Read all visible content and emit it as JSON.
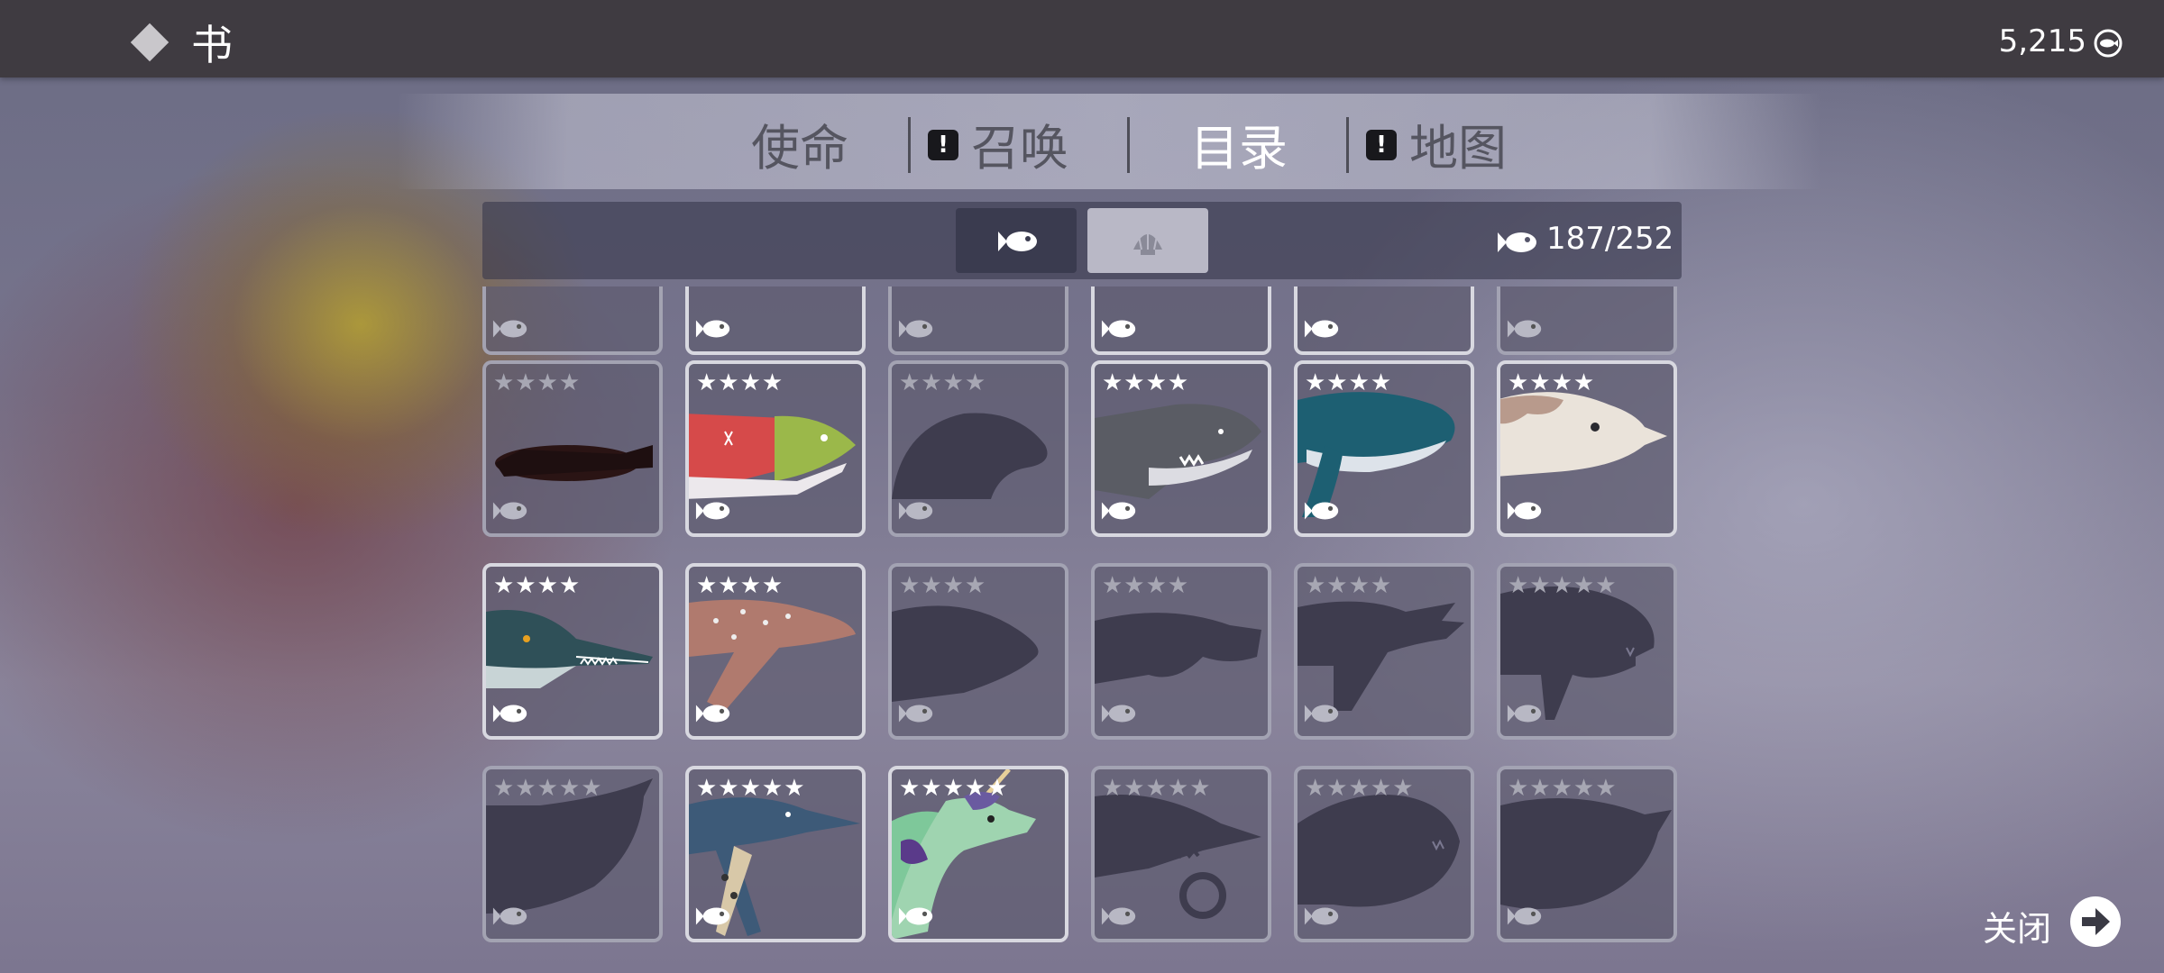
{
  "header": {
    "title": "书",
    "currency": "5,215"
  },
  "tabs": [
    {
      "label": "使命",
      "alert": false,
      "active": false
    },
    {
      "label": "召唤",
      "alert": true,
      "active": false
    },
    {
      "label": "目录",
      "alert": false,
      "active": true
    },
    {
      "label": "地图",
      "alert": true,
      "active": false
    }
  ],
  "alert_mark": "!",
  "filters": [
    {
      "icon": "fish-icon",
      "active": true
    },
    {
      "icon": "shell-icon",
      "active": false
    }
  ],
  "catalog": {
    "count": "187/252"
  },
  "cards": [
    {
      "stars": 4,
      "discovered": false,
      "creature": "red-silhouette"
    },
    {
      "stars": 4,
      "discovered": true,
      "creature": "sockeye-salmon"
    },
    {
      "stars": 4,
      "discovered": false,
      "creature": "seal-silhouette"
    },
    {
      "stars": 4,
      "discovered": true,
      "creature": "great-white-shark"
    },
    {
      "stars": 4,
      "discovered": true,
      "creature": "blue-whale"
    },
    {
      "stars": 4,
      "discovered": true,
      "creature": "dolphin-patterned"
    },
    {
      "stars": 4,
      "discovered": true,
      "creature": "gharial-fish"
    },
    {
      "stars": 4,
      "discovered": true,
      "creature": "spotted-shark"
    },
    {
      "stars": 4,
      "discovered": false,
      "creature": "fish-silhouette"
    },
    {
      "stars": 4,
      "discovered": false,
      "creature": "manatee-silhouette"
    },
    {
      "stars": 4,
      "discovered": false,
      "creature": "dinosaur-silhouette"
    },
    {
      "stars": 5,
      "discovered": false,
      "creature": "dunkleosteus-silhouette"
    },
    {
      "stars": 5,
      "discovered": false,
      "creature": "ray-silhouette"
    },
    {
      "stars": 5,
      "discovered": true,
      "creature": "ichthyosaur"
    },
    {
      "stars": 5,
      "discovered": true,
      "creature": "narwhal-dragon"
    },
    {
      "stars": 5,
      "discovered": false,
      "creature": "helicoprion-silhouette"
    },
    {
      "stars": 5,
      "discovered": false,
      "creature": "angler-silhouette"
    },
    {
      "stars": 5,
      "discovered": false,
      "creature": "whale-silhouette"
    }
  ],
  "partial_row": [
    {
      "discovered": false
    },
    {
      "discovered": true
    },
    {
      "discovered": false
    },
    {
      "discovered": true
    },
    {
      "discovered": true
    },
    {
      "discovered": false
    }
  ],
  "close": {
    "label": "关闭"
  }
}
